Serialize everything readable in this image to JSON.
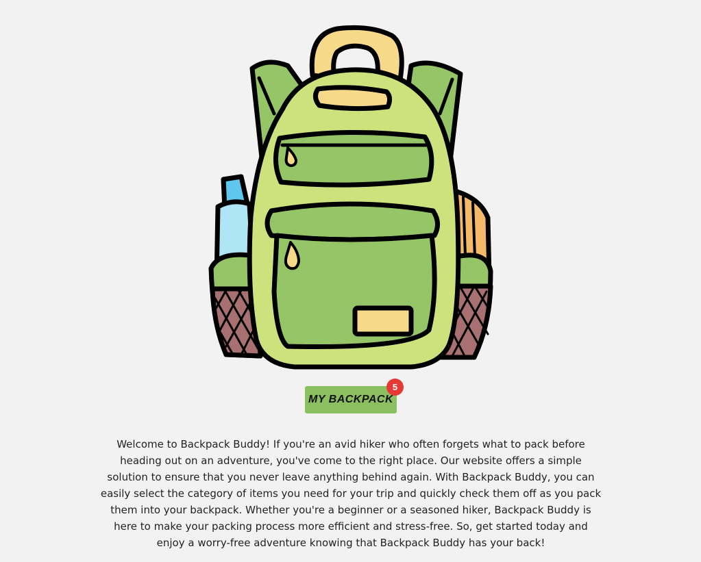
{
  "hero": {
    "image_name": "backpack-illustration"
  },
  "backpack_button": {
    "label": "MY BACKPACK",
    "badge_count": "5"
  },
  "intro": {
    "text": "Welcome to Backpack Buddy! If you're an avid hiker who often forgets what to pack before heading out on an adventure, you've come to the right place. Our website offers a simple solution to ensure that you never leave anything behind again. With Backpack Buddy, you can easily select the category of items you need for your trip and quickly check them off as you pack them into your backpack. Whether you're a beginner or a seasoned hiker, Backpack Buddy is here to make your packing process more efficient and stress-free. So, get started today and enjoy a worry-free adventure knowing that Backpack Buddy has your back!"
  },
  "colors": {
    "background": "#f2f2f2",
    "button": "#8cbf5f",
    "badge": "#e53935",
    "pack_light": "#cde27c",
    "pack_dark": "#96c567",
    "accent_yellow": "#f7d98a"
  }
}
